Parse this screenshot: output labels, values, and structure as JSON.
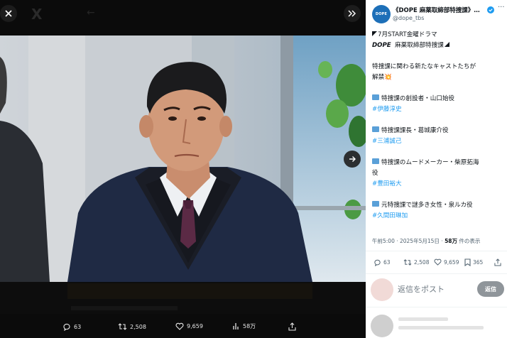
{
  "viewer": {
    "actions": {
      "replies": "63",
      "reposts": "2,508",
      "likes": "9,659",
      "views": "58万"
    }
  },
  "tweet": {
    "account_name": "《DOPE 麻薬取締部特捜課》…",
    "handle": "@dope_tbs",
    "avatar_text": "DOPE",
    "lines": {
      "l1": "7月START金曜ドラマ",
      "l2_a": "DOPE",
      "l2_b": "麻薬取締部特捜課",
      "l3": "特捜課に関わる新たなキャストたちが",
      "l4": "解禁💥",
      "r1_role": "特捜課の創設者・山口始役",
      "r1_tag": "#伊藤淳史",
      "r2_role": "特捜課課長・葛城康介役",
      "r2_tag": "#三浦誠己",
      "r3_role_a": "特捜課のムードメーカー・柴原拓海",
      "r3_role_b": "役",
      "r3_tag": "#豊田裕大",
      "r4_role": "元特捜課で謎多き女性・泉ルカ役",
      "r4_tag": "#久間田琳加"
    },
    "meta": {
      "time_date": "午前5:00 · 2025年5月15日 · ",
      "views_count": "58万",
      "views_suffix": " 件の表示"
    },
    "stats": {
      "replies": "63",
      "reposts": "2,508",
      "likes": "9,659",
      "bookmarks": "365"
    }
  },
  "reply": {
    "placeholder": "返信をポスト",
    "button_label": "返信"
  },
  "colors": {
    "accent": "#1d9bf0",
    "viewer_bg": "#0b0b0b",
    "reply_button": "#8f959a"
  },
  "icons": {
    "close": "close-icon",
    "expand": "expand-icon",
    "next": "arrow-right-icon",
    "reply": "reply-icon",
    "repost": "repost-icon",
    "like": "heart-icon",
    "views": "views-icon",
    "bookmark": "bookmark-icon",
    "share": "share-icon",
    "verified": "verified-icon",
    "more": "more-icon"
  }
}
